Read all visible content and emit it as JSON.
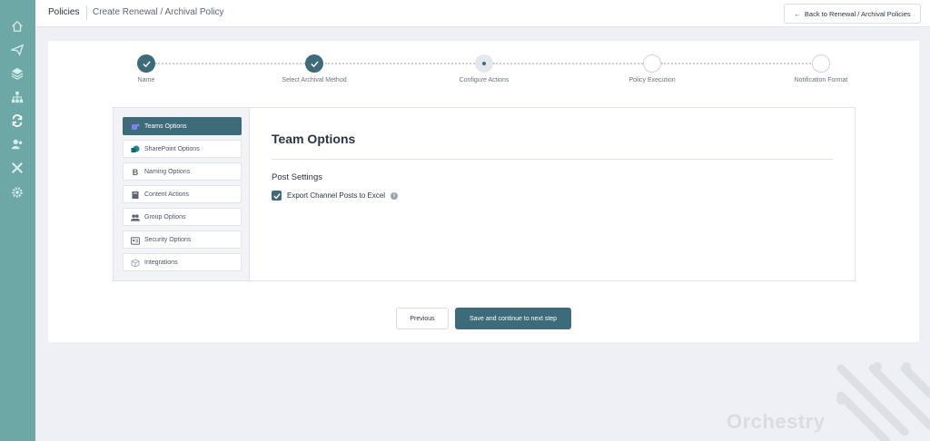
{
  "sidebar": {
    "icons": [
      "home-icon",
      "paper-plane-icon",
      "layers-icon",
      "sitemap-icon",
      "sync-icon",
      "users-icon",
      "tools-icon",
      "settings-icon"
    ]
  },
  "topbar": {
    "breadcrumb_root": "Policies",
    "breadcrumb_current": "Create Renewal / Archival Policy",
    "back_button": "Back to Renewal / Archival Policies"
  },
  "stepper": {
    "steps": [
      {
        "label": "Name",
        "state": "done"
      },
      {
        "label": "Select Archival Method",
        "state": "done"
      },
      {
        "label": "Configure Actions",
        "state": "active"
      },
      {
        "label": "Policy Execution",
        "state": "todo"
      },
      {
        "label": "Notification Format",
        "state": "todo"
      }
    ]
  },
  "left_nav": {
    "items": [
      {
        "label": "Teams Options",
        "icon": "teams-icon",
        "active": true
      },
      {
        "label": "SharePoint Options",
        "icon": "sharepoint-icon",
        "active": false
      },
      {
        "label": "Naming Options",
        "icon": "bold-b-icon",
        "active": false
      },
      {
        "label": "Content Actions",
        "icon": "book-icon",
        "active": false
      },
      {
        "label": "Group Options",
        "icon": "group-icon",
        "active": false
      },
      {
        "label": "Security Options",
        "icon": "id-card-icon",
        "active": false
      },
      {
        "label": "Integrations",
        "icon": "cube-icon",
        "active": false
      }
    ]
  },
  "content": {
    "title": "Team Options",
    "section_title": "Post Settings",
    "checkbox_label": "Export Channel Posts to Excel",
    "checkbox_checked": true,
    "info_glyph": "i"
  },
  "actions": {
    "previous": "Previous",
    "next": "Save and continue to next step"
  },
  "brand": {
    "name": "Orchestry"
  },
  "colors": {
    "sidebar": "#6da8a6",
    "accent": "#3e6b7a",
    "background": "#eef0f5"
  }
}
